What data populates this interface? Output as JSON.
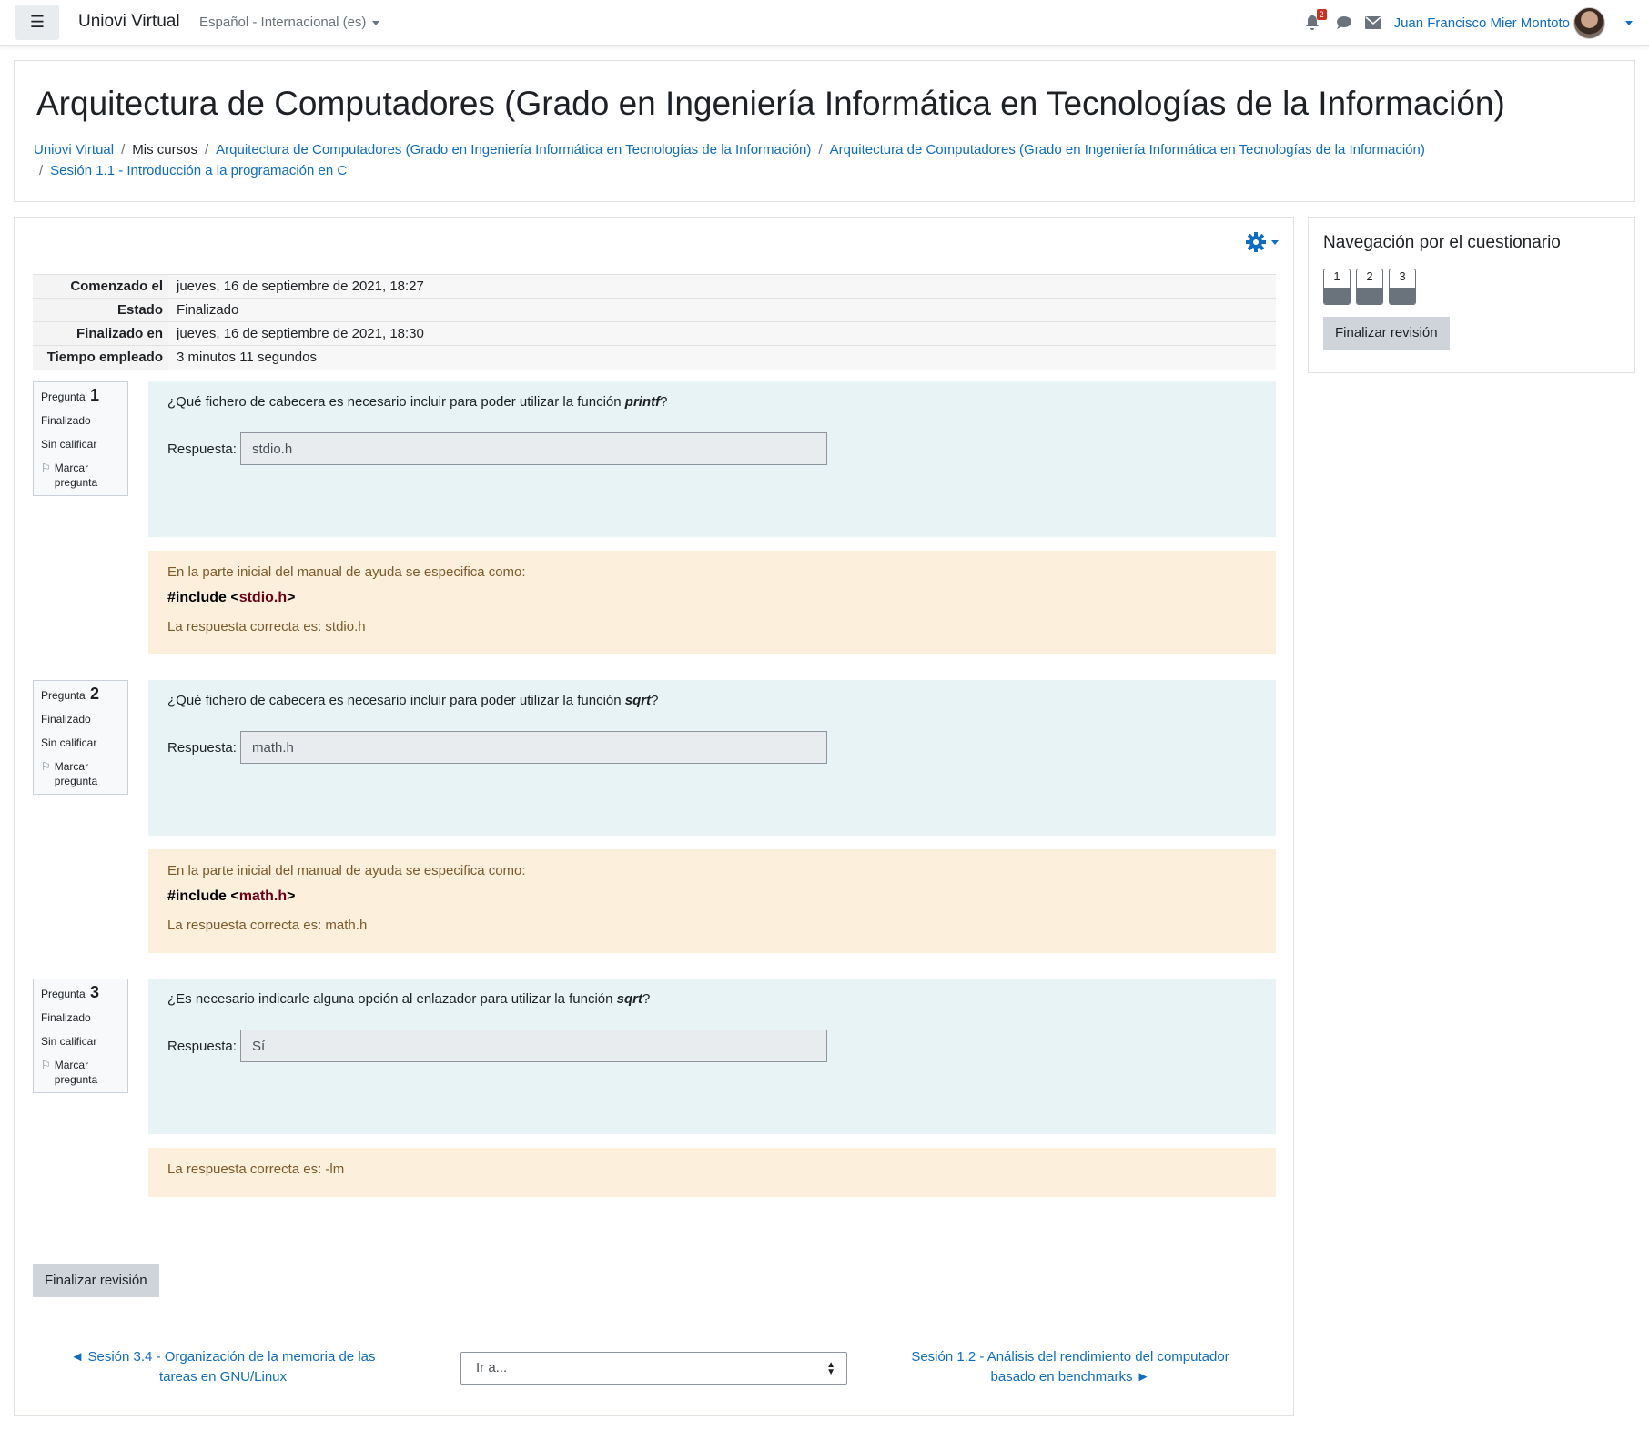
{
  "navbar": {
    "brand": "Uniovi Virtual",
    "language": "Español - Internacional (es)",
    "notifications_count": "2",
    "user_name": "Juan Francisco Mier Montoto"
  },
  "header": {
    "title": "Arquitectura de Computadores (Grado en Ingeniería Informática en Tecnologías de la Información)",
    "breadcrumb": [
      "Uniovi Virtual",
      "Mis cursos",
      "Arquitectura de Computadores (Grado en Ingeniería Informática en Tecnologías de la Información)",
      "Arquitectura de Computadores (Grado en Ingeniería Informática en Tecnologías de la Información)",
      "Sesión 1.1 - Introducción a la programación en C"
    ]
  },
  "summary": {
    "rows": [
      {
        "label": "Comenzado el",
        "value": "jueves, 16 de septiembre de 2021, 18:27"
      },
      {
        "label": "Estado",
        "value": "Finalizado"
      },
      {
        "label": "Finalizado en",
        "value": "jueves, 16 de septiembre de 2021, 18:30"
      },
      {
        "label": "Tiempo empleado",
        "value": "3 minutos 11 segundos"
      }
    ]
  },
  "questions": [
    {
      "label": "Pregunta",
      "number": "1",
      "status": "Finalizado",
      "grade": "Sin calificar",
      "flag": "Marcar pregunta",
      "text_pre": "¿Qué fichero de cabecera es necesario incluir para poder utilizar la función ",
      "text_em": "printf",
      "text_post": "?",
      "answer_label": "Respuesta:",
      "answer": "stdio.h",
      "fb_intro": "En la parte inicial del manual de ayuda se especifica como:",
      "fb_code_pre": "#include <",
      "fb_code_name": "stdio.h",
      "fb_code_post": ">",
      "fb_correct": "La respuesta correcta es: stdio.h"
    },
    {
      "label": "Pregunta",
      "number": "2",
      "status": "Finalizado",
      "grade": "Sin calificar",
      "flag": "Marcar pregunta",
      "text_pre": "¿Qué fichero de cabecera es necesario incluir para poder utilizar la función ",
      "text_em": "sqrt",
      "text_post": "?",
      "answer_label": "Respuesta:",
      "answer": "math.h",
      "fb_intro": "En la parte inicial del manual de ayuda se especifica como:",
      "fb_code_pre": "#include <",
      "fb_code_name": "math.h",
      "fb_code_post": ">",
      "fb_correct": "La respuesta correcta es: math.h"
    },
    {
      "label": "Pregunta",
      "number": "3",
      "status": "Finalizado",
      "grade": "Sin calificar",
      "flag": "Marcar pregunta",
      "text_pre": "¿Es necesario indicarle alguna opción al enlazador para utilizar la función ",
      "text_em": "sqrt",
      "text_post": "?",
      "answer_label": "Respuesta:",
      "answer": "Sí",
      "fb_correct": "La respuesta correcta es: -lm"
    }
  ],
  "finish_button": "Finalizar revisión",
  "footer_nav": {
    "prev": "◄ Sesión 3.4 - Organización de la memoria de las tareas en GNU/Linux",
    "jump": "Ir a...",
    "next": "Sesión 1.2 - Análisis del rendimiento del computador basado en benchmarks ►"
  },
  "quiz_nav": {
    "title": "Navegación por el cuestionario",
    "buttons": [
      "1",
      "2",
      "3"
    ],
    "finish": "Finalizar revisión"
  }
}
